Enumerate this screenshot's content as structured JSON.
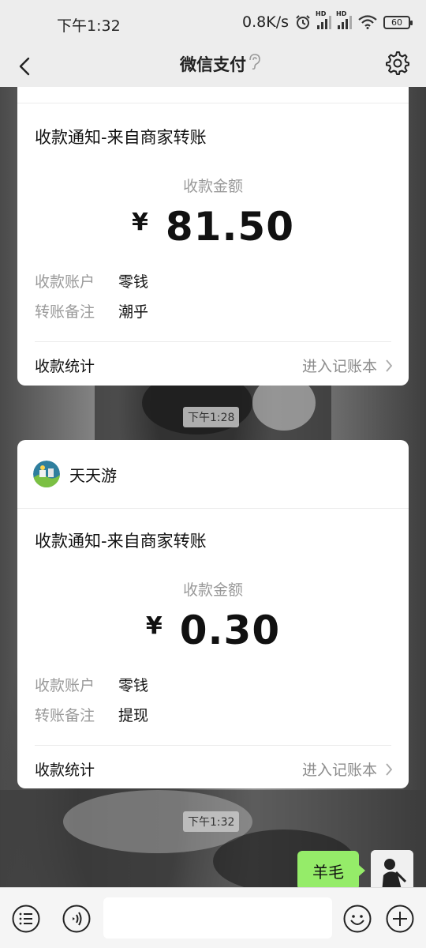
{
  "status": {
    "time": "下午1:32",
    "speed": "0.8K/s",
    "battery": "60"
  },
  "nav": {
    "title": "微信支付"
  },
  "cards": [
    {
      "title": "收款通知-来自商家转账",
      "amount_label": "收款金额",
      "currency": "¥",
      "amount": "81.50",
      "account_label": "收款账户",
      "account_value": "零钱",
      "note_label": "转账备注",
      "note_value": "潮乎",
      "stats_label": "收款统计",
      "ledger_link": "进入记账本"
    },
    {
      "merchant": "天天游",
      "title": "收款通知-来自商家转账",
      "amount_label": "收款金额",
      "currency": "¥",
      "amount": "0.30",
      "account_label": "收款账户",
      "account_value": "零钱",
      "note_label": "转账备注",
      "note_value": "提现",
      "stats_label": "收款统计",
      "ledger_link": "进入记账本"
    }
  ],
  "timestamps": [
    "下午1:28",
    "下午1:32"
  ],
  "my_message": "羊毛",
  "colors": {
    "accent_green": "#95ec69",
    "bar_bg": "#ededed"
  },
  "icons": [
    "back-icon",
    "ear-icon",
    "gear-icon",
    "list-icon",
    "voice-icon",
    "emoji-icon",
    "plus-icon",
    "chevron-right-icon"
  ]
}
